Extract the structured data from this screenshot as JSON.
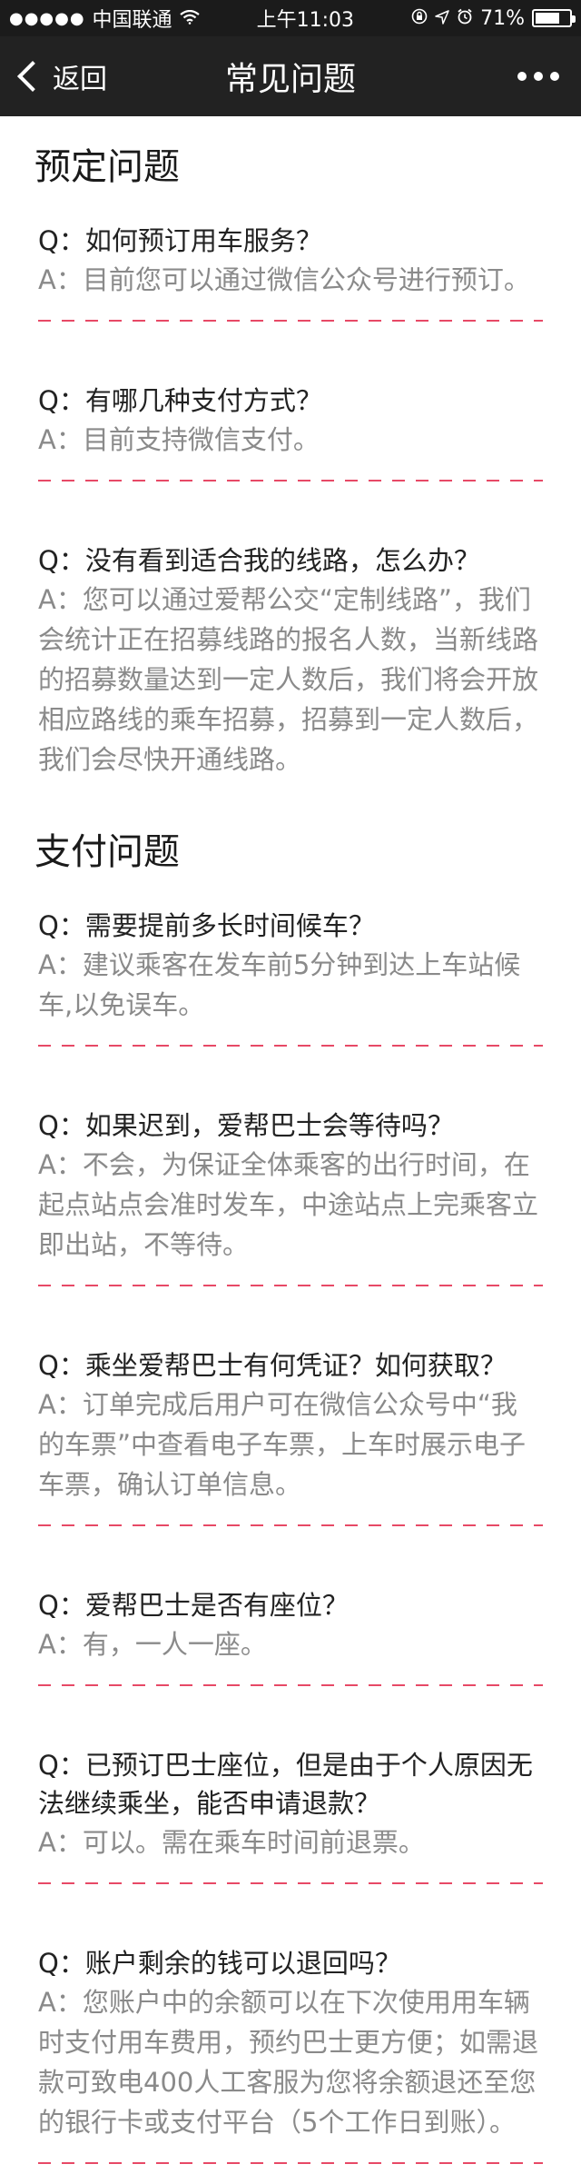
{
  "status_bar": {
    "signal_dots": "●●●●●",
    "carrier": "中国联通",
    "time": "上午11:03",
    "battery_percent": "71%",
    "battery_level": 0.71
  },
  "nav": {
    "back_label": "返回",
    "title": "常见问题"
  },
  "sections": [
    {
      "title": "预定问题",
      "items": [
        {
          "q": "Q：如何预订用车服务？",
          "a": "A：目前您可以通过微信公众号进行预订。"
        },
        {
          "q": "Q：有哪几种支付方式？",
          "a": "A：目前支持微信支付。"
        },
        {
          "q": "Q：没有看到适合我的线路，怎么办？",
          "a": "A：您可以通过爱帮公交“定制线路”，我们会统计正在招募线路的报名人数，当新线路的招募数量达到一定人数后，我们将会开放相应路线的乘车招募，招募到一定人数后，我们会尽快开通线路。"
        }
      ]
    },
    {
      "title": "支付问题",
      "items": [
        {
          "q": "Q：需要提前多长时间候车？",
          "a": "A：建议乘客在发车前5分钟到达上车站候车,以免误车。"
        },
        {
          "q": "Q：如果迟到，爱帮巴士会等待吗？",
          "a": "A：不会，为保证全体乘客的出行时间，在起点站点会准时发车，中途站点上完乘客立即出站，不等待。"
        },
        {
          "q": "Q：乘坐爱帮巴士有何凭证？如何获取？",
          "a": "A：订单完成后用户可在微信公众号中“我的车票”中查看电子车票，上车时展示电子车票，确认订单信息。"
        },
        {
          "q": "Q：爱帮巴士是否有座位？",
          "a": "A：有，一人一座。"
        },
        {
          "q": "Q：已预订巴士座位，但是由于个人原因无法继续乘坐，能否申请退款？",
          "a": "A：可以。需在乘车时间前退票。"
        },
        {
          "q": "Q：账户剩余的钱可以退回吗？",
          "a": "A：您账户中的余额可以在下次使用用车辆时支付用车费用，预约巴士更方便；如需退款可致电400人工客服为您将余额退还至您的银行卡或支付平台（5个工作日到账）。"
        }
      ]
    }
  ],
  "colors": {
    "header_bg": "#222222",
    "divider": "#e74966",
    "answer_text": "#8a8a8a"
  },
  "icons": [
    "wifi-icon",
    "lock-rotation-icon",
    "location-arrow-icon",
    "alarm-icon",
    "battery-icon",
    "back-chevron-icon",
    "more-icon"
  ]
}
